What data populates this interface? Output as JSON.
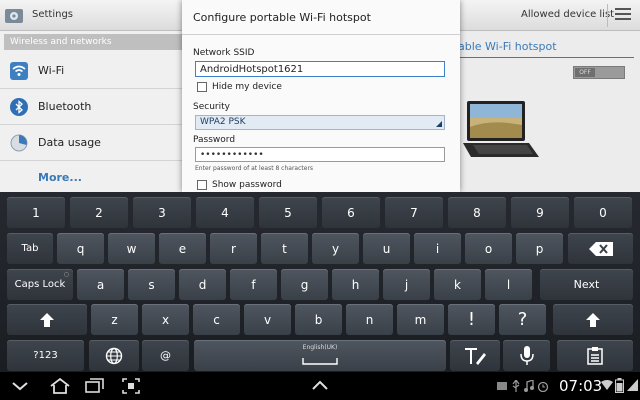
{
  "settings": {
    "title": "Settings",
    "allowed_devices": "Allowed device list",
    "category": "Wireless and networks",
    "items": [
      {
        "label": "Wi-Fi",
        "icon": "wifi-icon"
      },
      {
        "label": "Bluetooth",
        "icon": "bluetooth-icon"
      },
      {
        "label": "Data usage",
        "icon": "data-usage-icon"
      }
    ],
    "more": "More...",
    "panel_title": "able Wi-Fi hotspot",
    "toggle_state": "OFF"
  },
  "dialog": {
    "title": "Configure portable Wi-Fi hotspot",
    "ssid_label": "Network SSID",
    "ssid_value": "AndroidHotspot1621",
    "hide_label": "Hide my device",
    "security_label": "Security",
    "security_value": "WPA2 PSK",
    "password_label": "Password",
    "password_value": "••••••••••••",
    "password_hint": "Enter password of at least 8 characters",
    "show_password": "Show password"
  },
  "keyboard": {
    "row1": [
      "1",
      "2",
      "3",
      "4",
      "5",
      "6",
      "7",
      "8",
      "9",
      "0"
    ],
    "tab": "Tab",
    "row2": [
      "q",
      "w",
      "e",
      "r",
      "t",
      "y",
      "u",
      "i",
      "o",
      "p"
    ],
    "caps": "Caps Lock",
    "row3": [
      "a",
      "s",
      "d",
      "f",
      "g",
      "h",
      "j",
      "k",
      "l"
    ],
    "next": "Next",
    "row4": [
      "z",
      "x",
      "c",
      "v",
      "b",
      "n",
      "m",
      "!",
      "?"
    ],
    "sym": "?123",
    "at": "@",
    "space_lang": "English(UK)"
  },
  "status": {
    "time": "07:03"
  },
  "colors": {
    "accent": "#3a7ab8",
    "keyboard_bg": "#1f2227"
  }
}
